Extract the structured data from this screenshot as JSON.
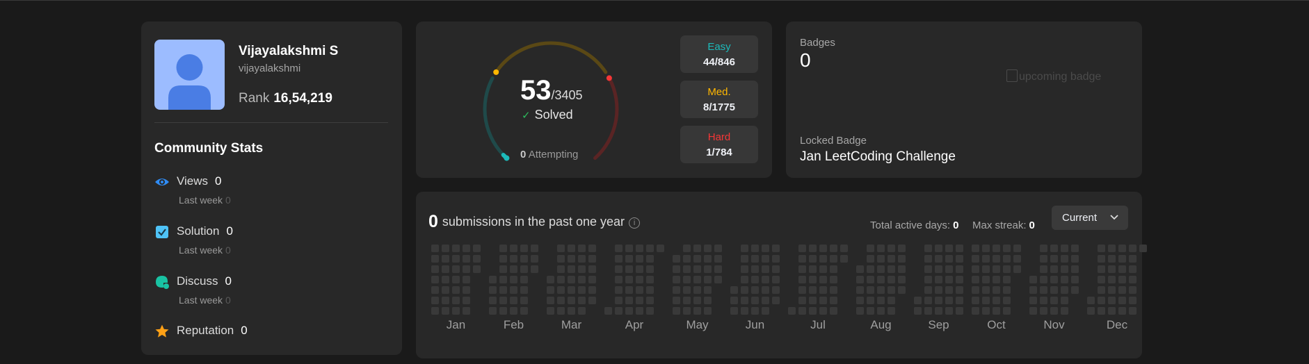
{
  "profile": {
    "name": "Vijayalakshmi S",
    "username": "vijayalakshmi",
    "rank_label": "Rank",
    "rank_value": "16,54,219"
  },
  "community": {
    "title": "Community Stats",
    "stats": [
      {
        "label": "Views",
        "value": "0",
        "sub_label": "Last week",
        "sub_value": "0",
        "icon": "eye-icon",
        "color": "#2f8cf5"
      },
      {
        "label": "Solution",
        "value": "0",
        "sub_label": "Last week",
        "sub_value": "0",
        "icon": "check-square-icon",
        "color": "#4fc3f7"
      },
      {
        "label": "Discuss",
        "value": "0",
        "sub_label": "Last week",
        "sub_value": "0",
        "icon": "discuss-icon",
        "color": "#19c3a3"
      },
      {
        "label": "Reputation",
        "value": "0",
        "icon": "star-icon",
        "color": "#ffa116"
      }
    ]
  },
  "solved": {
    "count": "53",
    "total": "/3405",
    "label": "Solved",
    "attempting_count": "0",
    "attempting_label": "Attempting",
    "fraction": 0.0156,
    "difficulties": [
      {
        "label": "Easy",
        "value": "44/846",
        "color": "#1cbaba"
      },
      {
        "label": "Med.",
        "value": "8/1775",
        "color": "#ffb700"
      },
      {
        "label": "Hard",
        "value": "1/784",
        "color": "#f63737"
      }
    ]
  },
  "badges": {
    "title": "Badges",
    "count": "0",
    "image_alt": "upcoming badge",
    "locked_label": "Locked Badge",
    "locked_name": "Jan LeetCoding Challenge"
  },
  "submissions": {
    "count": "0",
    "text": "submissions in the past one year",
    "info_icon": "info-icon",
    "active_days_label": "Total active days:",
    "active_days_value": "0",
    "max_streak_label": "Max streak:",
    "max_streak_value": "0",
    "range_select": "Current",
    "months": [
      "Jan",
      "Feb",
      "Mar",
      "Apr",
      "May",
      "Jun",
      "Jul",
      "Aug",
      "Sep",
      "Oct",
      "Nov",
      "Dec"
    ]
  },
  "colors": {
    "background": "#1a1a1a",
    "card": "#282828",
    "empty_cell": "#393939"
  }
}
